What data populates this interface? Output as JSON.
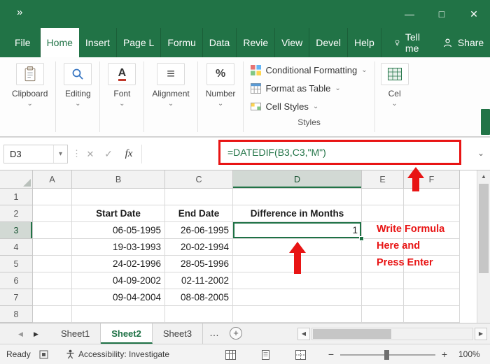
{
  "icons": {
    "qat_overflow": "»",
    "minimize": "—",
    "maximize": "□",
    "close": "✕",
    "chevron_down": "⌄",
    "dropdown": "▾",
    "separator_dots": "⋮",
    "cancel": "✕",
    "enter": "✓",
    "fx": "fx",
    "scroll_up": "▲",
    "tab_nav_left": "◀",
    "tab_nav_right": "▶",
    "scroll_left": "◀",
    "scroll_right": "▶",
    "zoom_out": "−",
    "zoom_in": "+",
    "font_glyph": "A",
    "align_glyph": "≡",
    "percent_glyph": "%"
  },
  "menubar": {
    "items": [
      "File",
      "Home",
      "Insert",
      "Page L",
      "Formu",
      "Data",
      "Revie",
      "View",
      "Devel",
      "Help"
    ],
    "active_item": "Home",
    "tell_me": "Tell me",
    "share": "Share"
  },
  "ribbon": {
    "groups": [
      {
        "label": "Clipboard"
      },
      {
        "label": "Editing"
      },
      {
        "label": "Font"
      },
      {
        "label": "Alignment"
      },
      {
        "label": "Number"
      }
    ],
    "styles": {
      "items": [
        "Conditional Formatting",
        "Format as Table",
        "Cell Styles"
      ],
      "label": "Styles"
    },
    "cells_label": "Cel"
  },
  "formula_bar": {
    "name_box": "D3",
    "formula": "=DATEDIF(B3,C3,\"M\")"
  },
  "sheet": {
    "col_headers": [
      "A",
      "B",
      "C",
      "D",
      "E",
      "F"
    ],
    "row_headers": [
      "1",
      "2",
      "3",
      "4",
      "5",
      "6",
      "7",
      "8"
    ],
    "selected_column": "D",
    "selected_row": "3",
    "active_cell": "D3",
    "table": {
      "start_header": "Start Date",
      "end_header": "End Date",
      "diff_header": "Difference in Months",
      "rows": [
        {
          "start": "06-05-1995",
          "end": "26-06-1995",
          "diff": "1"
        },
        {
          "start": "19-03-1993",
          "end": "20-02-1994",
          "diff": ""
        },
        {
          "start": "24-02-1996",
          "end": "28-05-1996",
          "diff": ""
        },
        {
          "start": "04-09-2002",
          "end": "02-11-2002",
          "diff": ""
        },
        {
          "start": "09-04-2004",
          "end": "08-08-2005",
          "diff": ""
        }
      ]
    }
  },
  "annotations": {
    "line1": "Write Formula",
    "line2": "Here and",
    "line3": "Press Enter"
  },
  "tabbar": {
    "tabs": [
      "Sheet1",
      "Sheet2",
      "Sheet3"
    ],
    "active_tab": "Sheet2",
    "more": "…",
    "add": "+"
  },
  "statusbar": {
    "ready": "Ready",
    "accessibility": "Accessibility: Investigate",
    "zoom_level": "100%"
  },
  "colors": {
    "excel_green": "#217346",
    "selection_green": "#1e7145",
    "annotation_red": "#e81414"
  }
}
